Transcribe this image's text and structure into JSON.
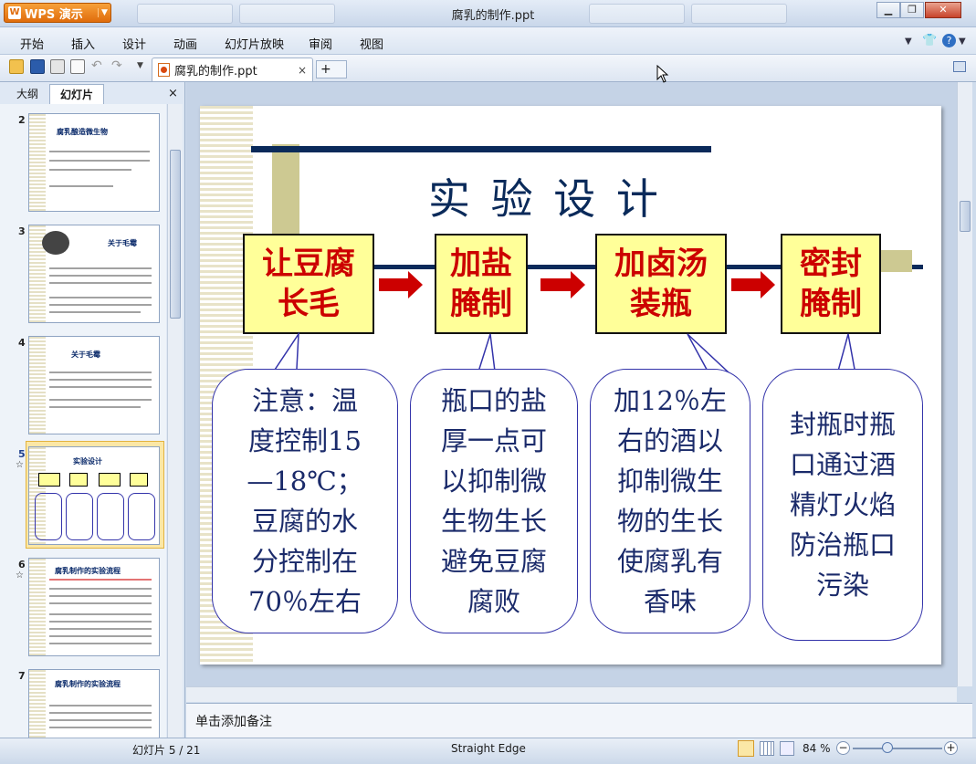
{
  "app": {
    "brand": "WPS 演示",
    "window_title": "腐乳的制作.ppt"
  },
  "menu": [
    "开始",
    "插入",
    "设计",
    "动画",
    "幻灯片放映",
    "审阅",
    "视图"
  ],
  "doc_tab": {
    "label": "腐乳的制作.ppt",
    "close": "×",
    "new_tab": "+"
  },
  "left_panel": {
    "tab_outline": "大纲",
    "tab_slides": "幻灯片",
    "close": "×",
    "thumbs": [
      {
        "num": "2",
        "title": "腐乳酿造微生物"
      },
      {
        "num": "3",
        "title": "关于毛霉"
      },
      {
        "num": "4",
        "title": "关于毛霉"
      },
      {
        "num": "5",
        "title": "实验设计"
      },
      {
        "num": "6",
        "title": "腐乳制作的实验流程"
      },
      {
        "num": "7",
        "title": "腐乳制作的实验流程"
      }
    ]
  },
  "slide": {
    "title": "实 验 设 计",
    "steps": [
      "让豆腐\n长毛",
      "加盐\n腌制",
      "加卤汤\n装瓶",
      "密封\n腌制"
    ],
    "notes": [
      "注意：温\n度控制15\n—18℃；\n豆腐的水\n分控制在\n70％左右",
      "瓶口的盐\n厚一点可\n以抑制微\n生物生长\n避免豆腐\n腐败",
      "加12％左\n右的酒以\n抑制微生\n物的生长\n使腐乳有\n香味",
      "封瓶时瓶\n口通过酒\n精灯火焰\n防治瓶口\n污染"
    ]
  },
  "notes_placeholder": "单击添加备注",
  "status": {
    "slide_counter": "幻灯片 5 / 21",
    "theme": "Straight Edge",
    "zoom": "84 %"
  },
  "colors": {
    "accent_red": "#cc0000",
    "box_fill": "#ffff99",
    "navy": "#0a2a5a"
  }
}
